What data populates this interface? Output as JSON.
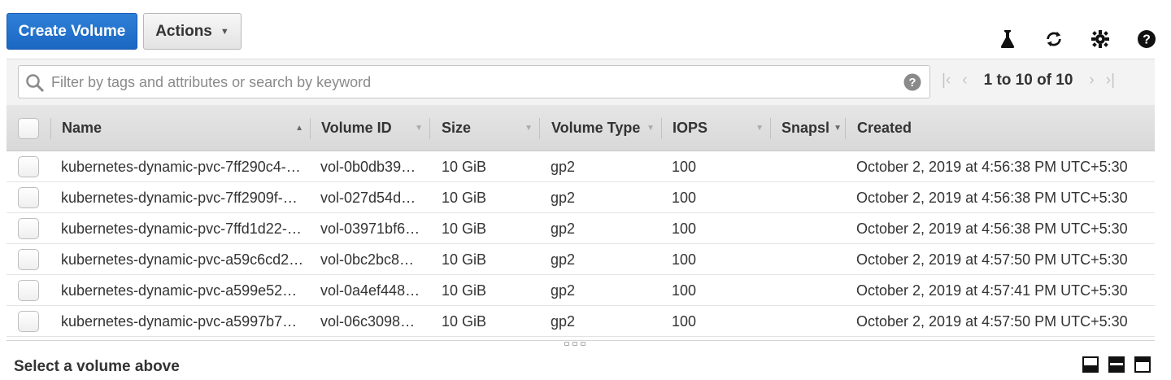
{
  "toolbar": {
    "create_label": "Create Volume",
    "actions_label": "Actions",
    "icons": [
      "beaker-icon",
      "refresh-icon",
      "gear-icon",
      "help-icon"
    ]
  },
  "filter": {
    "placeholder": "Filter by tags and attributes or search by keyword",
    "pager_text": "1 to 10 of 10"
  },
  "columns": [
    "Name",
    "Volume ID",
    "Size",
    "Volume Type",
    "IOPS",
    "Snapsl",
    "Created"
  ],
  "rows": [
    {
      "name": "kubernetes-dynamic-pvc-7ff290c4-…",
      "volume_id": "vol-0b0db39…",
      "size": "10 GiB",
      "type": "gp2",
      "iops": "100",
      "snapshot": "",
      "created": "October 2, 2019 at 4:56:38 PM UTC+5:30"
    },
    {
      "name": "kubernetes-dynamic-pvc-7ff2909f-…",
      "volume_id": "vol-027d54d…",
      "size": "10 GiB",
      "type": "gp2",
      "iops": "100",
      "snapshot": "",
      "created": "October 2, 2019 at 4:56:38 PM UTC+5:30"
    },
    {
      "name": "kubernetes-dynamic-pvc-7ffd1d22-…",
      "volume_id": "vol-03971bf6…",
      "size": "10 GiB",
      "type": "gp2",
      "iops": "100",
      "snapshot": "",
      "created": "October 2, 2019 at 4:56:38 PM UTC+5:30"
    },
    {
      "name": "kubernetes-dynamic-pvc-a59c6cd2…",
      "volume_id": "vol-0bc2bc8…",
      "size": "10 GiB",
      "type": "gp2",
      "iops": "100",
      "snapshot": "",
      "created": "October 2, 2019 at 4:57:50 PM UTC+5:30"
    },
    {
      "name": "kubernetes-dynamic-pvc-a599e52…",
      "volume_id": "vol-0a4ef448…",
      "size": "10 GiB",
      "type": "gp2",
      "iops": "100",
      "snapshot": "",
      "created": "October 2, 2019 at 4:57:41 PM UTC+5:30"
    },
    {
      "name": "kubernetes-dynamic-pvc-a5997b7…",
      "volume_id": "vol-06c3098…",
      "size": "10 GiB",
      "type": "gp2",
      "iops": "100",
      "snapshot": "",
      "created": "October 2, 2019 at 4:57:50 PM UTC+5:30"
    }
  ],
  "bottom": {
    "message": "Select a volume above"
  },
  "colors": {
    "primary": "#1a67c2",
    "header_bg": "#dddddd"
  }
}
